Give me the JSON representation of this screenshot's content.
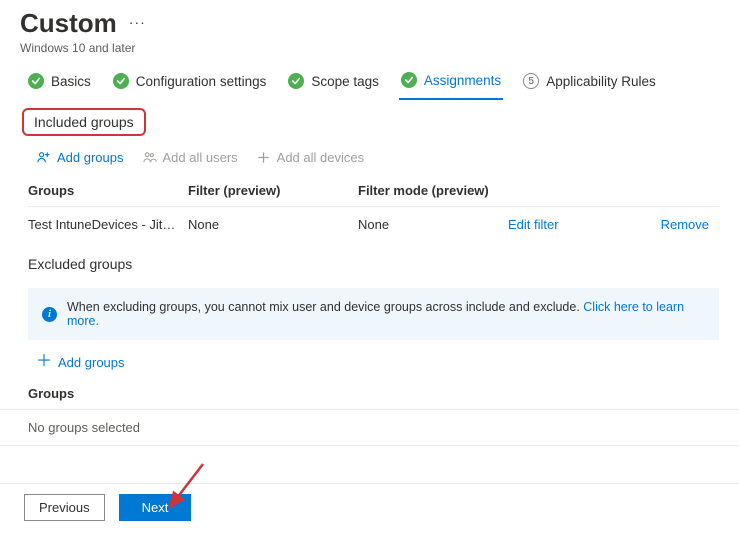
{
  "header": {
    "title": "Custom",
    "subtitle": "Windows 10 and later"
  },
  "stepper": {
    "steps": [
      {
        "label": "Basics",
        "state": "done"
      },
      {
        "label": "Configuration settings",
        "state": "done"
      },
      {
        "label": "Scope tags",
        "state": "done"
      },
      {
        "label": "Assignments",
        "state": "active"
      },
      {
        "label": "Applicability Rules",
        "state": "pending",
        "num": "5"
      }
    ]
  },
  "included": {
    "heading": "Included groups",
    "toolbar": {
      "add_groups": "Add groups",
      "add_all_users": "Add all users",
      "add_all_devices": "Add all devices"
    },
    "columns": {
      "groups": "Groups",
      "filter": "Filter (preview)",
      "filter_mode": "Filter mode (preview)"
    },
    "rows": [
      {
        "group": "Test IntuneDevices - Jit…",
        "filter": "None",
        "filter_mode": "None",
        "edit": "Edit filter",
        "remove": "Remove"
      }
    ]
  },
  "excluded": {
    "heading": "Excluded groups",
    "info_text": "When excluding groups, you cannot mix user and device groups across include and exclude. ",
    "info_link": "Click here to learn more.",
    "add_groups": "Add groups",
    "groups_heading": "Groups",
    "empty": "No groups selected"
  },
  "footer": {
    "previous": "Previous",
    "next": "Next"
  }
}
